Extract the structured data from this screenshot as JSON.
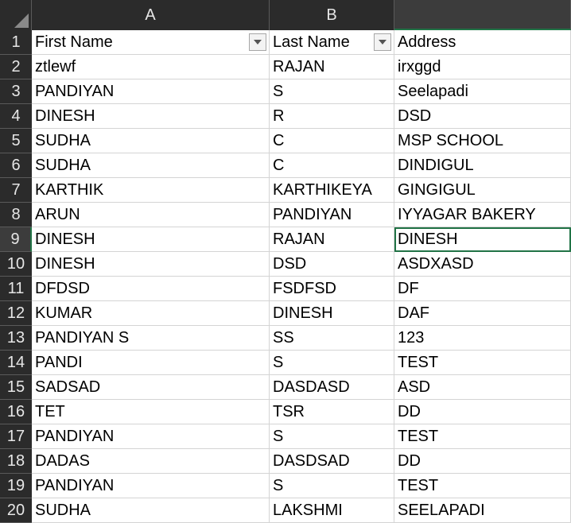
{
  "columns": {
    "a": "A",
    "b": "B",
    "c": ""
  },
  "row_numbers": [
    "1",
    "2",
    "3",
    "4",
    "5",
    "6",
    "7",
    "8",
    "9",
    "10",
    "11",
    "12",
    "13",
    "14",
    "15",
    "16",
    "17",
    "18",
    "19",
    "20"
  ],
  "headers": {
    "first_name": "First Name",
    "last_name": "Last Name",
    "address": "Address"
  },
  "rows": [
    [
      "ztlewf",
      "RAJAN",
      "irxggd"
    ],
    [
      "PANDIYAN",
      "S",
      "Seelapadi"
    ],
    [
      "DINESH",
      "R",
      "DSD"
    ],
    [
      "SUDHA",
      "C",
      "MSP SCHOOL"
    ],
    [
      "SUDHA",
      "C",
      "DINDIGUL"
    ],
    [
      "KARTHIK",
      "KARTHIKEYA",
      "GINGIGUL"
    ],
    [
      "ARUN",
      "PANDIYAN",
      "IYYAGAR BAKERY"
    ],
    [
      "DINESH",
      "RAJAN",
      "DINESH"
    ],
    [
      "DINESH",
      "DSD",
      "ASDXASD"
    ],
    [
      "DFDSD",
      "FSDFSD",
      "DF"
    ],
    [
      "KUMAR",
      "DINESH",
      "DAF"
    ],
    [
      "PANDIYAN S",
      "SS",
      "123"
    ],
    [
      "PANDI",
      "S",
      "TEST"
    ],
    [
      "SADSAD",
      "DASDASD",
      "ASD"
    ],
    [
      "TET",
      "TSR",
      "DD"
    ],
    [
      "PANDIYAN",
      "S",
      "TEST"
    ],
    [
      "DADAS",
      "DASDSAD",
      "DD"
    ],
    [
      "PANDIYAN",
      "S",
      "TEST"
    ],
    [
      "SUDHA",
      "LAKSHMI",
      "SEELAPADI"
    ]
  ],
  "colors": {
    "header_bg": "#2b2b2b",
    "selection": "#217346"
  }
}
